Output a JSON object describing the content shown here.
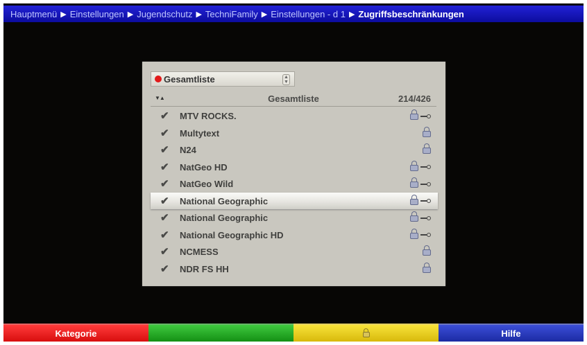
{
  "breadcrumb": [
    "Hauptmenü",
    "Einstellungen",
    "Jugendschutz",
    "TechniFamily",
    "Einstellungen - d 1",
    "Zugriffsbeschränkungen"
  ],
  "list_select": {
    "value": "Gesamtliste"
  },
  "list": {
    "title": "Gesamtliste",
    "count": "214/426",
    "channels": [
      {
        "name": "MTV ROCKS.",
        "icons": [
          "lock-icon",
          "key-icon"
        ]
      },
      {
        "name": "Multytext",
        "icons": [
          "lock-icon"
        ]
      },
      {
        "name": "N24",
        "icons": [
          "lock-icon"
        ]
      },
      {
        "name": "NatGeo HD",
        "icons": [
          "lock-icon",
          "key-icon"
        ]
      },
      {
        "name": "NatGeo Wild",
        "icons": [
          "lock-icon",
          "key-icon"
        ]
      },
      {
        "name": "National Geographic",
        "icons": [
          "lock-icon",
          "key-icon"
        ],
        "selected": true
      },
      {
        "name": "National Geographic",
        "icons": [
          "lock-icon",
          "key-icon"
        ]
      },
      {
        "name": "National Geographic HD",
        "icons": [
          "lock-icon",
          "key-icon"
        ]
      },
      {
        "name": "NCMESS",
        "icons": [
          "lock-icon"
        ]
      },
      {
        "name": "NDR FS HH",
        "icons": [
          "lock-icon"
        ]
      }
    ]
  },
  "footer": {
    "red_label": "Kategorie",
    "green_label": "",
    "yellow_icon": "lock-icon",
    "blue_label": "Hilfe"
  },
  "colors": {
    "breadcrumb_bg": "#1616c0",
    "panel_bg": "#c9c7bf",
    "red": "#e31b1b",
    "green": "#1fa81f",
    "yellow": "#e7c81a",
    "blue": "#2537bd"
  }
}
